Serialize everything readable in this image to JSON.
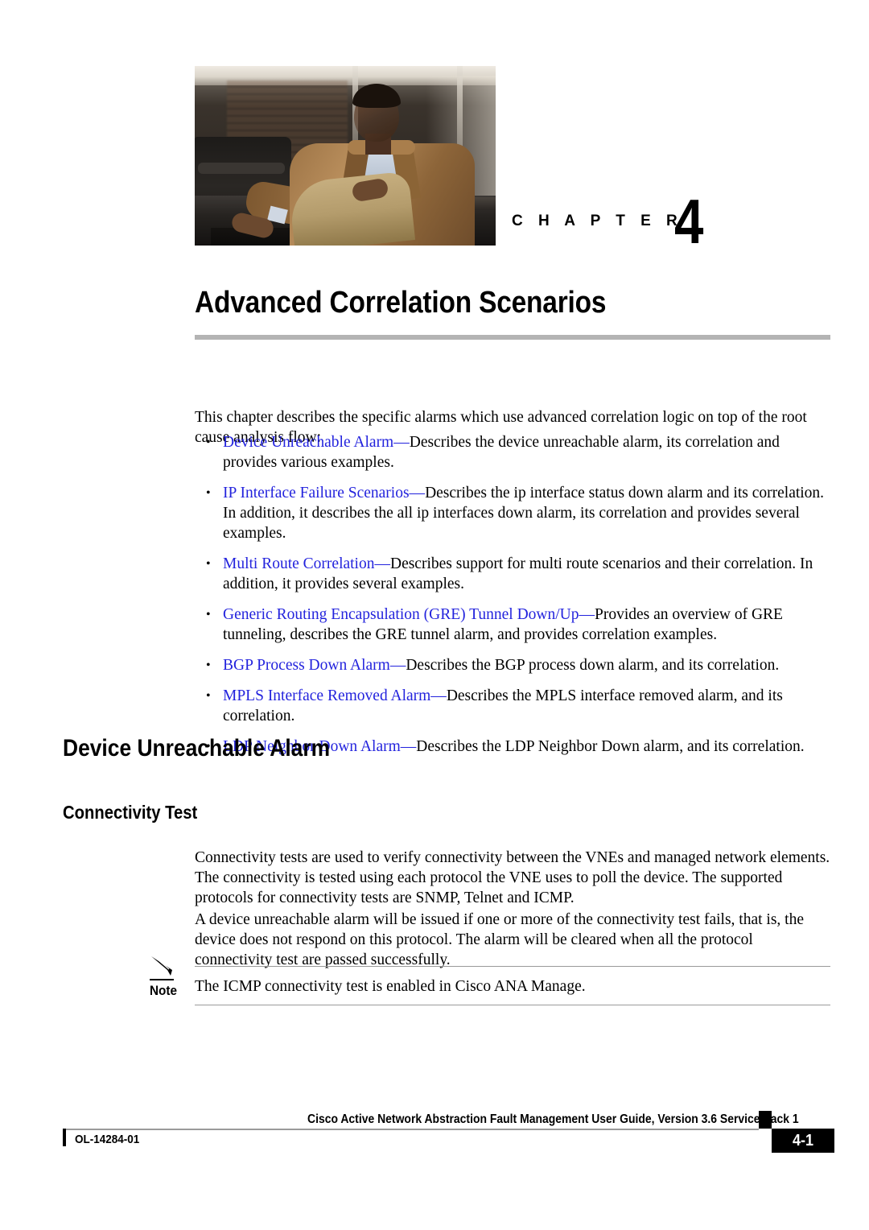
{
  "chapter": {
    "label": "C H A P T E R",
    "number": "4",
    "title": "Advanced Correlation Scenarios",
    "photo_icon": "chapter-opener-photo"
  },
  "intro": {
    "paragraph": "This chapter describes the specific alarms which use advanced correlation logic on top of the root cause analysis flow:"
  },
  "bullets": [
    {
      "bullet": "•",
      "link": "Device Unreachable Alarm—",
      "text": "Describes the device unreachable alarm, its correlation and provides various examples."
    },
    {
      "bullet": "•",
      "link": "IP Interface Failure Scenarios—",
      "text": "Describes the ip interface status down alarm and its correlation. In addition, it describes the all ip interfaces down alarm, its correlation and provides several examples."
    },
    {
      "bullet": "•",
      "link": "Multi Route Correlation—",
      "text": "Describes support for multi route scenarios and their correlation. In addition, it provides several examples."
    },
    {
      "bullet": "•",
      "link": "Generic Routing Encapsulation (GRE) Tunnel Down/Up—",
      "text": "Provides an overview of GRE tunneling, describes the GRE tunnel alarm, and provides correlation examples."
    },
    {
      "bullet": "•",
      "link": "BGP Process Down Alarm—",
      "text": "Describes the BGP process down alarm, and its correlation."
    },
    {
      "bullet": "•",
      "link": "MPLS Interface Removed Alarm—",
      "text": "Describes the MPLS interface removed alarm, and its correlation."
    },
    {
      "bullet": "•",
      "link": "LDP Neighbor Down Alarm—",
      "text": "Describes the LDP Neighbor Down alarm, and its correlation."
    }
  ],
  "sections": {
    "device_unreachable_alarm": "Device Unreachable Alarm",
    "connectivity_test": "Connectivity Test"
  },
  "body": {
    "para_connectivity": "Connectivity tests are used to verify connectivity between the VNEs and managed network elements. The connectivity is tested using each protocol the VNE uses to poll the device. The supported protocols for connectivity tests are SNMP, Telnet and ICMP.",
    "para_alarm": "A device unreachable alarm will be issued if one or more of the connectivity test fails, that is, the device does not respond on this protocol. The alarm will be cleared when all the protocol connectivity test are passed successfully."
  },
  "note": {
    "icon": "pencil-icon",
    "label": "Note",
    "text": "The ICMP connectivity test is enabled in Cisco ANA Manage."
  },
  "footer": {
    "guide_title": "Cisco Active Network Abstraction Fault Management User Guide, Version 3.6 Service Pack 1",
    "doc_number": "OL-14284-01",
    "page_number": "4-1"
  },
  "colors": {
    "link": "#2323dd",
    "rule_gray": "#b4b4b4",
    "hairline_gray": "#9a9a9a",
    "page_box": "#000000"
  }
}
